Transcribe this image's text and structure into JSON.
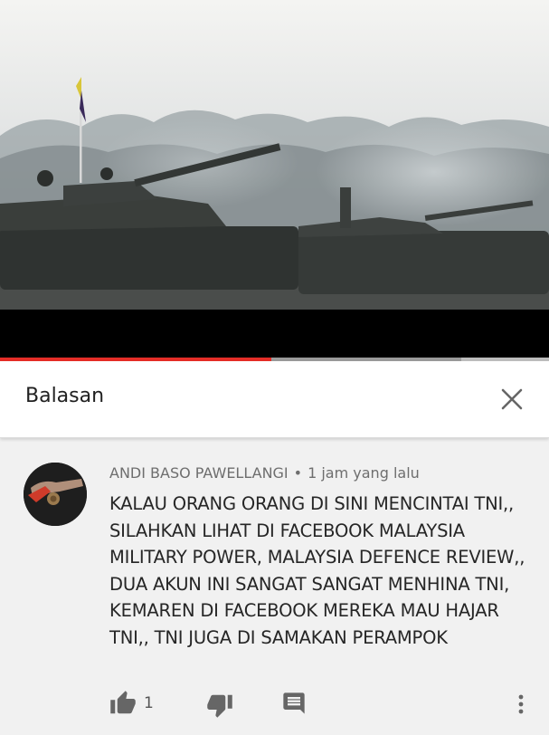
{
  "video": {
    "progress_fraction": 0.495,
    "buffer_fraction": 0.84
  },
  "replies_panel": {
    "title": "Balasan"
  },
  "comment": {
    "author": "ANDI BASO PAWELLANGI",
    "separator": "•",
    "time": "1 jam yang lalu",
    "text": "KALAU ORANG ORANG DI SINI MENCINTAI TNI,, SILAHKAN LIHAT DI FACEBOOK MALAYSIA MILITARY POWER, MALAYSIA DEFENCE REVIEW,, DUA AKUN INI SANGAT SANGAT MENHINA TNI, KEMAREN DI FACEBOOK MEREKA MAU HAJAR TNI,, TNI JUGA DI SAMAKAN PERAMPOK",
    "like_count": "1"
  },
  "icons": {
    "close": "close-icon",
    "like": "thumbs-up-icon",
    "dislike": "thumbs-down-icon",
    "reply": "comment-icon",
    "more": "more-vert-icon"
  },
  "colors": {
    "progress": "#e52d27",
    "header_bg": "#ffffff",
    "comment_bg": "#f1f1f1",
    "icon_gray": "#666666"
  }
}
